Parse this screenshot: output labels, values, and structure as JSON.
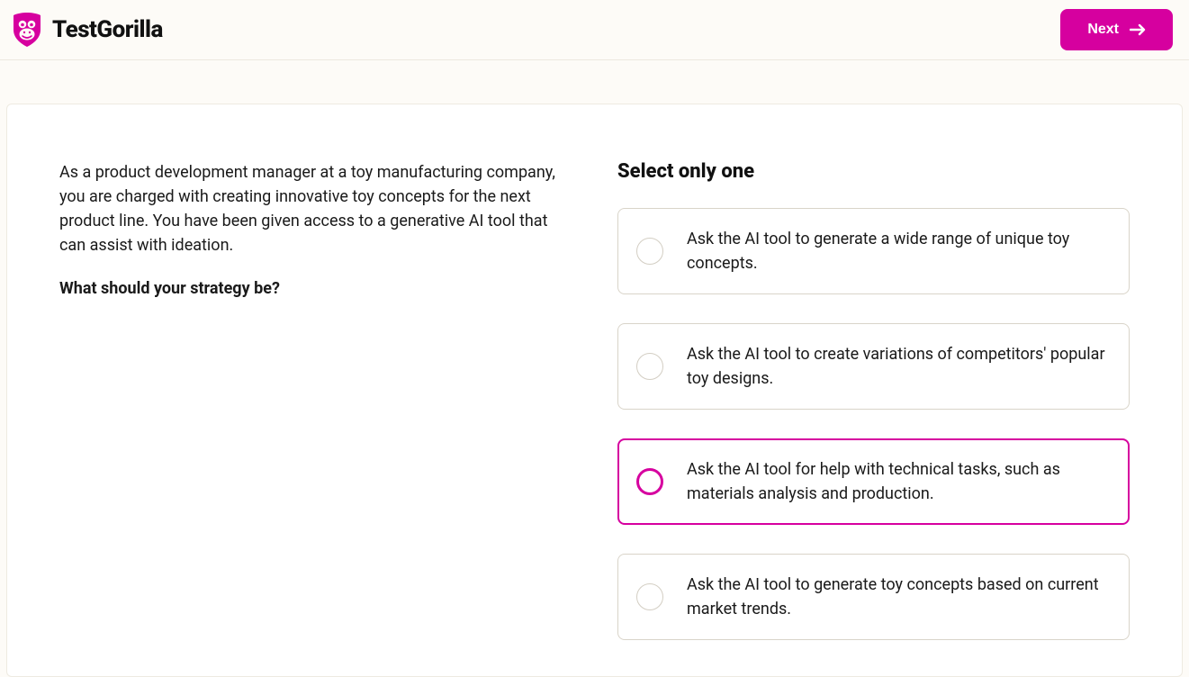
{
  "brand": {
    "name": "TestGorilla",
    "accent": "#d6009f"
  },
  "header": {
    "next_label": "Next"
  },
  "question": {
    "prompt": "As a product development manager at a toy manufacturing company, you are charged with creating innovative toy concepts for the next product line. You have been given access to a generative AI tool that can assist with ideation.",
    "ask": "What should your strategy be?",
    "instruction": "Select only one",
    "selected_index": 2,
    "options": [
      "Ask the AI tool to generate a wide range of unique toy concepts.",
      "Ask the AI tool to create variations of competitors' popular toy designs.",
      "Ask the AI tool for help with technical tasks, such as materials analysis and production.",
      "Ask the AI tool to generate toy concepts based on current market trends."
    ]
  }
}
